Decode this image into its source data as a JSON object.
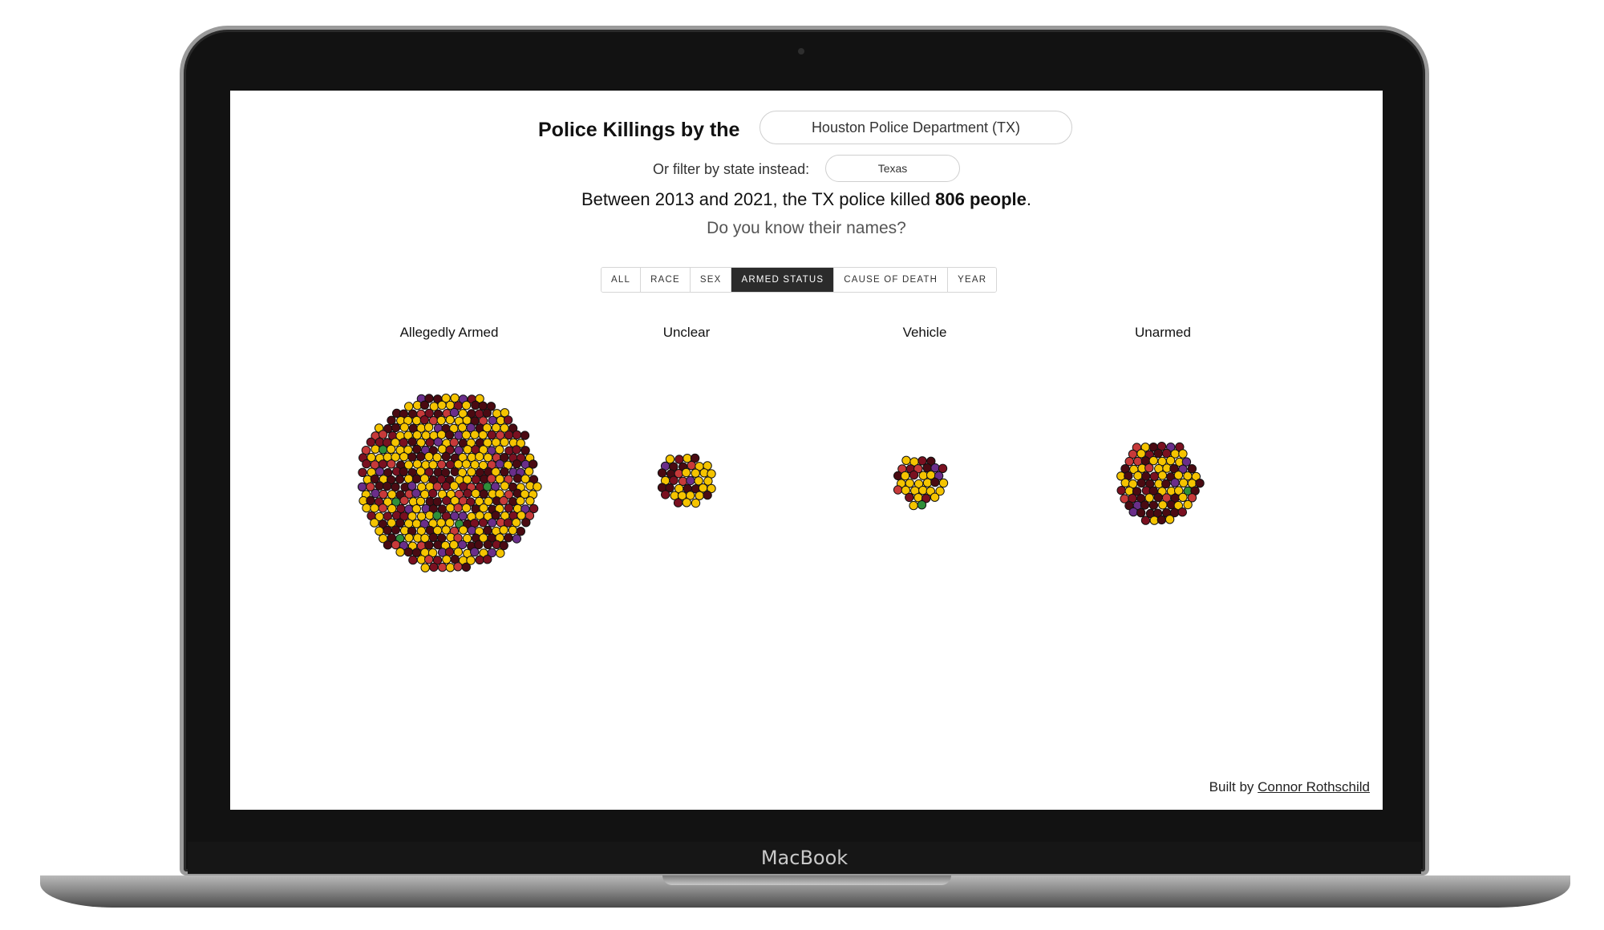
{
  "header": {
    "title": "Police Killings by the",
    "department_select": "Houston Police Department (TX)",
    "state_filter_label": "Or filter by state instead:",
    "state_select": "Texas"
  },
  "summary": {
    "prefix": "Between 2013 and 2021, the TX police killed ",
    "count": "806 people",
    "suffix": ".",
    "question": "Do you know their names?"
  },
  "tabs": [
    {
      "label": "ALL",
      "active": false
    },
    {
      "label": "RACE",
      "active": false
    },
    {
      "label": "SEX",
      "active": false
    },
    {
      "label": "ARMED STATUS",
      "active": true
    },
    {
      "label": "CAUSE OF DEATH",
      "active": false
    },
    {
      "label": "YEAR",
      "active": false
    }
  ],
  "groups": [
    {
      "label": "Allegedly Armed",
      "cluster_size": "large"
    },
    {
      "label": "Unclear",
      "cluster_size": "small"
    },
    {
      "label": "Vehicle",
      "cluster_size": "small"
    },
    {
      "label": "Unarmed",
      "cluster_size": "medium"
    }
  ],
  "colors": {
    "dot_palette": [
      "#f5c400",
      "#4a0a12",
      "#7a1020",
      "#c73a3a",
      "#6a2e8a",
      "#2f8f3a"
    ],
    "dot_stroke": "#111111",
    "active_tab": "#2b2b2b"
  },
  "footer": {
    "built_by": "Built by ",
    "author": "Connor Rothschild"
  },
  "device": {
    "brand": "MacBook"
  }
}
